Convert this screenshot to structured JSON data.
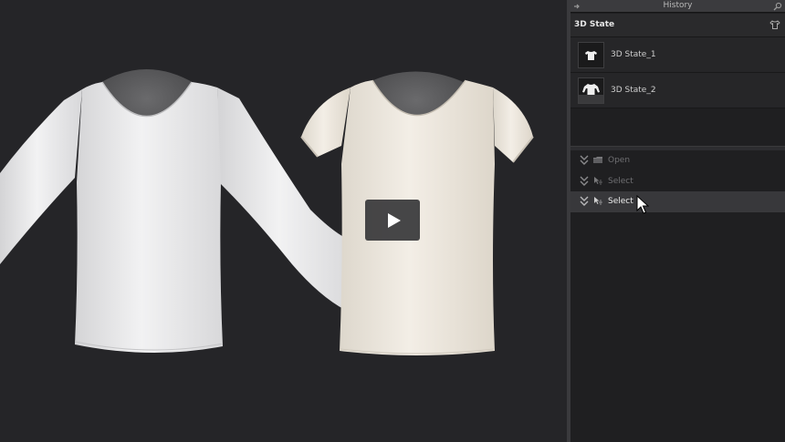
{
  "viewport": {
    "play_button_icon": "play-icon",
    "garments": [
      "long-sleeve-white-shirt",
      "short-sleeve-cream-shirt"
    ],
    "colors": {
      "background": "#252528",
      "white_garment": "#e9e9ea",
      "cream_garment": "#ece6dc",
      "avatar": "#5e5e60"
    }
  },
  "panel": {
    "title": "History",
    "section_title": "3D State",
    "states": [
      {
        "label": "3D State_1",
        "thumb_icon": "short-sleeve-shirt-thumbnail"
      },
      {
        "label": "3D State_2",
        "thumb_icon": "long-sleeve-shirt-thumbnail"
      }
    ],
    "history": [
      {
        "label": "Open",
        "icon": "folder-open-icon",
        "active": false
      },
      {
        "label": "Select",
        "icon": "select-arrow-icon",
        "active": false
      },
      {
        "label": "Select",
        "icon": "select-arrow-icon",
        "active": true
      }
    ]
  }
}
